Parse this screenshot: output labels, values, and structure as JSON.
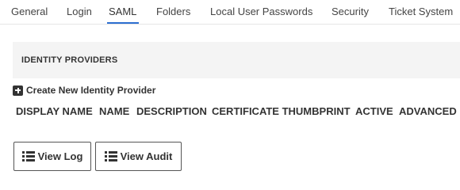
{
  "tabs": [
    {
      "label": "General"
    },
    {
      "label": "Login"
    },
    {
      "label": "SAML"
    },
    {
      "label": "Folders"
    },
    {
      "label": "Local User Passwords"
    },
    {
      "label": "Security"
    },
    {
      "label": "Ticket System"
    }
  ],
  "active_tab": "SAML",
  "section": {
    "title": "IDENTITY PROVIDERS"
  },
  "create_link": {
    "label": "Create New Identity Provider",
    "icon": "plus-square-icon"
  },
  "table": {
    "columns": [
      "DISPLAY NAME",
      "NAME",
      "DESCRIPTION",
      "CERTIFICATE THUMBPRINT",
      "ACTIVE",
      "ADVANCED"
    ]
  },
  "buttons": {
    "view_log": {
      "label": "View Log",
      "icon": "list-icon"
    },
    "view_audit": {
      "label": "View Audit",
      "icon": "list-icon"
    }
  },
  "colors": {
    "accent": "#2d6fd0",
    "section_bg": "#f4f4f4",
    "text": "#333333"
  }
}
